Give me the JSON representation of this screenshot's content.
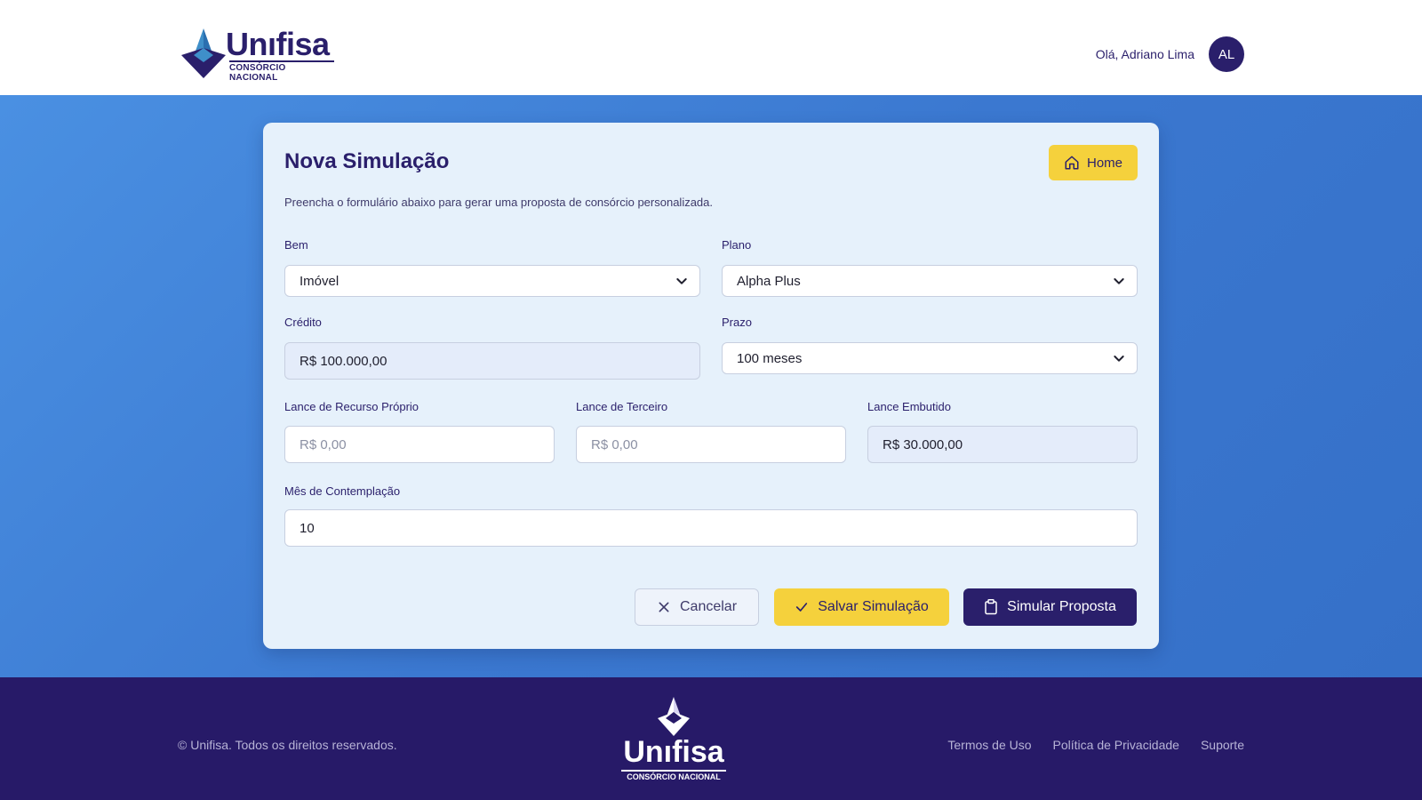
{
  "header": {
    "logo_brand": "Unıfisa",
    "logo_tag": "CONSÓRCIO NACIONAL",
    "greeting": "Olá, Adriano Lima",
    "avatar_initials": "AL"
  },
  "card": {
    "title": "Nova Simulação",
    "home_label": "Home",
    "subtitle": "Preencha o formulário abaixo para gerar uma proposta de consórcio personalizada."
  },
  "form": {
    "bem": {
      "label": "Bem",
      "value": "Imóvel"
    },
    "plano": {
      "label": "Plano",
      "value": "Alpha Plus"
    },
    "credito": {
      "label": "Crédito",
      "value": "R$ 100.000,00"
    },
    "prazo": {
      "label": "Prazo",
      "value": "100 meses"
    },
    "lance_proprio": {
      "label": "Lance de Recurso Próprio",
      "placeholder": "R$ 0,00"
    },
    "lance_terceiro": {
      "label": "Lance de Terceiro",
      "placeholder": "R$ 0,00"
    },
    "lance_embutido": {
      "label": "Lance Embutido",
      "value": "R$ 30.000,00"
    },
    "mes_contemplacao": {
      "label": "Mês de Contemplação",
      "value": "10"
    }
  },
  "actions": {
    "cancel": "Cancelar",
    "save": "Salvar Simulação",
    "simulate": "Simular Proposta"
  },
  "footer": {
    "copyright": "© Unifisa. Todos os direitos reservados.",
    "logo_brand": "Unıfisa",
    "logo_tag": "CONSÓRCIO NACIONAL",
    "links": [
      "Termos de Uso",
      "Política de Privacidade",
      "Suporte"
    ]
  },
  "colors": {
    "brand_navy": "#2a1f6b",
    "accent_yellow": "#f5d13c",
    "band_blue": "#4a90e2",
    "footer_bg": "#271a68"
  }
}
